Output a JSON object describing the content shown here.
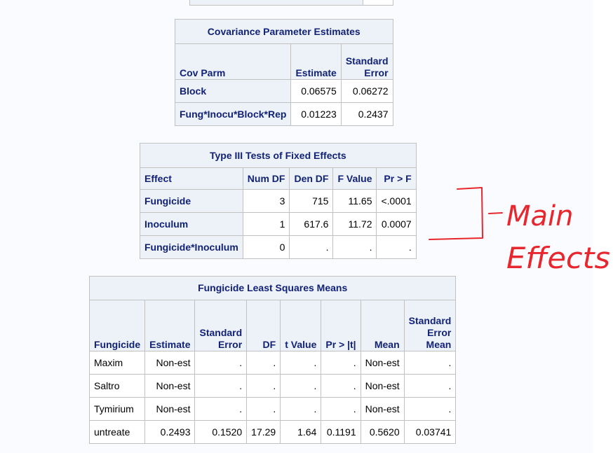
{
  "top_fragment": {},
  "covariance": {
    "title": "Covariance Parameter Estimates",
    "headers": {
      "cov_parm": "Cov Parm",
      "estimate": "Estimate",
      "se_line1": "Standard",
      "se_line2": "Error"
    },
    "rows": [
      {
        "cov_parm": "Block",
        "estimate": "0.06575",
        "se": "0.06272"
      },
      {
        "cov_parm": "Fung*Inocu*Block*Rep",
        "estimate": "0.01223",
        "se": "0.2437"
      }
    ]
  },
  "type3": {
    "title": "Type III Tests of Fixed Effects",
    "headers": {
      "effect": "Effect",
      "num_df": "Num DF",
      "den_df": "Den DF",
      "f_value": "F Value",
      "pr_f": "Pr > F"
    },
    "rows": [
      {
        "effect": "Fungicide",
        "num_df": "3",
        "den_df": "715",
        "f_value": "11.65",
        "pr_f": "<.0001"
      },
      {
        "effect": "Inoculum",
        "num_df": "1",
        "den_df": "617.6",
        "f_value": "11.72",
        "pr_f": "0.0007"
      },
      {
        "effect": "Fungicide*Inoculum",
        "num_df": "0",
        "den_df": ".",
        "f_value": ".",
        "pr_f": "."
      }
    ]
  },
  "lsmeans": {
    "title": "Fungicide Least Squares Means",
    "headers": {
      "fungicide": "Fungicide",
      "estimate": "Estimate",
      "se_line1": "Standard",
      "se_line2": "Error",
      "df": "DF",
      "t_value": "t Value",
      "pr_t": "Pr > |t|",
      "mean": "Mean",
      "sem_line1": "Standard",
      "sem_line2": "Error",
      "sem_line3": "Mean"
    },
    "rows": [
      {
        "fungicide": "Maxim",
        "estimate": "Non-est",
        "se": ".",
        "df": ".",
        "t_value": ".",
        "pr_t": ".",
        "mean": "Non-est",
        "sem": "."
      },
      {
        "fungicide": "Saltro",
        "estimate": "Non-est",
        "se": ".",
        "df": ".",
        "t_value": ".",
        "pr_t": ".",
        "mean": "Non-est",
        "sem": "."
      },
      {
        "fungicide": "Tymirium",
        "estimate": "Non-est",
        "se": ".",
        "df": ".",
        "t_value": ".",
        "pr_t": ".",
        "mean": "Non-est",
        "sem": "."
      },
      {
        "fungicide": "untreate",
        "estimate": "0.2493",
        "se": "0.1520",
        "df": "17.29",
        "t_value": "1.64",
        "pr_t": "0.1191",
        "mean": "0.5620",
        "sem": "0.03741"
      }
    ]
  },
  "annotation": {
    "text_line1": "Main",
    "text_line2": "Effects",
    "ink_color": "#e8262d"
  },
  "colors": {
    "header_bg": "#edf2f9",
    "header_text": "#112277",
    "border": "#c1c1c1"
  }
}
